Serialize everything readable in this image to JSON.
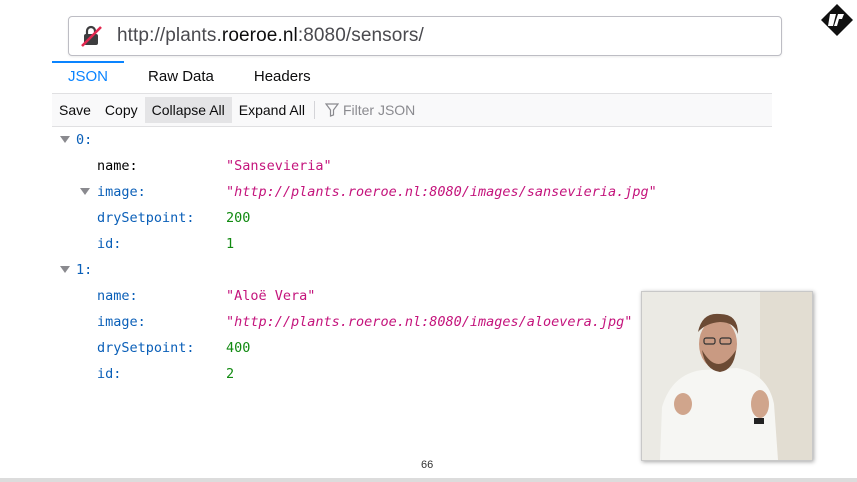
{
  "url": {
    "prefix": "http://plants.",
    "domain": "roeroe.nl",
    "suffix": ":8080/sensors/"
  },
  "tabs": [
    {
      "label": "JSON"
    },
    {
      "label": "Raw Data"
    },
    {
      "label": "Headers"
    }
  ],
  "toolbar": {
    "save": "Save",
    "copy": "Copy",
    "collapse": "Collapse All",
    "expand": "Expand All",
    "filter_placeholder": "Filter JSON"
  },
  "items": [
    {
      "index": "0:",
      "name_key": "name:",
      "name": "\"Sansevieria\"",
      "image_key": "image:",
      "image": "http://plants.roeroe.nl:8080/images/sansevieria.jpg",
      "dry_key": "drySetpoint:",
      "dry": "200",
      "id_key": "id:",
      "id": "1"
    },
    {
      "index": "1:",
      "name_key": "name:",
      "name": "\"Aloë Vera\"",
      "image_key": "image:",
      "image": "http://plants.roeroe.nl:8080/images/aloevera.jpg",
      "dry_key": "drySetpoint:",
      "dry": "400",
      "id_key": "id:",
      "id": "2"
    }
  ],
  "page_number": "66",
  "colors": {
    "accent": "#0a84ff",
    "key": "#0a5fb8",
    "string": "#c4147c",
    "number": "#118a11"
  }
}
